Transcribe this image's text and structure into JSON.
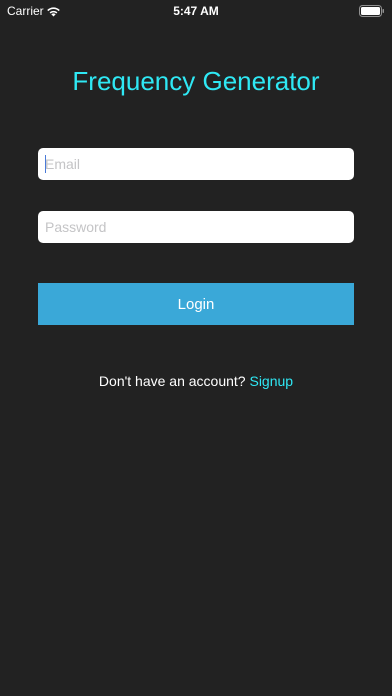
{
  "status_bar": {
    "carrier": "Carrier",
    "time": "5:47 AM",
    "wifi_icon": "wifi-icon",
    "battery_icon": "battery-icon"
  },
  "login": {
    "title": "Frequency Generator",
    "email_placeholder": "Email",
    "email_value": "",
    "password_placeholder": "Password",
    "password_value": "",
    "button_label": "Login",
    "signup_prompt": "Don't have an account?",
    "signup_link": "Signup"
  },
  "colors": {
    "background": "#222222",
    "accent": "#2fe8f4",
    "button": "#3aa8d8",
    "field_background": "#ffffff"
  }
}
